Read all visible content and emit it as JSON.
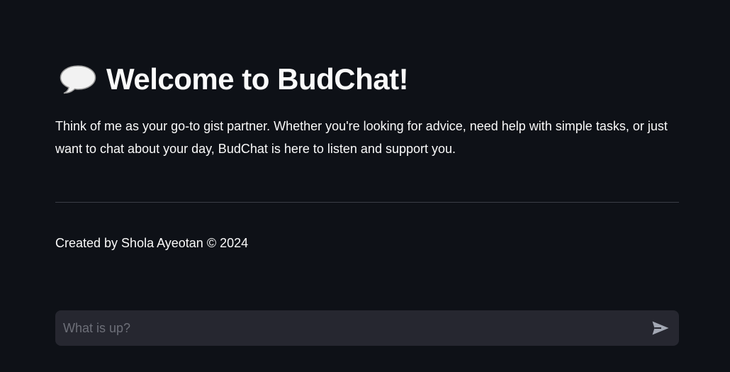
{
  "header": {
    "icon": "speech-balloon-icon",
    "title": "Welcome to BudChat!"
  },
  "intro": {
    "text": "Think of me as your go-to gist partner. Whether you're looking for advice, need help with simple tasks, or just want to chat about your day, BudChat is here to listen and support you."
  },
  "footer": {
    "credit": "Created by Shola Ayeotan © 2024"
  },
  "chat_input": {
    "placeholder": "What is up?",
    "value": "",
    "send_icon": "send-icon"
  },
  "colors": {
    "background": "#0e1117",
    "text": "#fafafa",
    "input_background": "#262730",
    "placeholder": "#6d6f78",
    "send_icon": "#a3a8b4",
    "divider": "#3a3d46"
  }
}
